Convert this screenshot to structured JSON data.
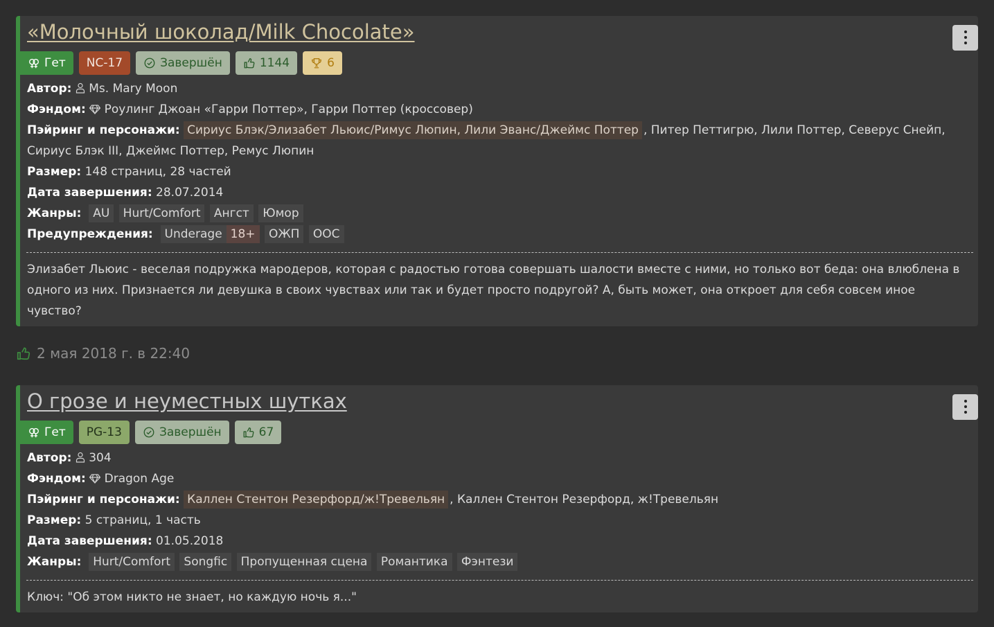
{
  "fics": [
    {
      "title": "«Молочный шоколад/Milk Chocolate»",
      "direction": "Гет",
      "rating": "NC-17",
      "status": "Завершён",
      "likes": "1144",
      "awards": "6",
      "author_label": "Автор:",
      "author": "Ms. Mary Moon",
      "fandom_label": "Фэндом:",
      "fandom": "Роулинг Джоан «Гарри Поттер», Гарри Поттер (кроссовер)",
      "pairing_label": "Пэйринг и персонажи:",
      "pairing_highlight": "Сириус Блэк/Элизабет Льюис/Римус Люпин, Лили Эванс/Джеймс Поттер",
      "pairing_rest_line1": ", Питер Петтигрю, Лили Поттер, Северус Снейп,",
      "pairing_rest_line2": "Сириус Блэк III, Джеймс Поттер, Ремус Люпин",
      "size_label": "Размер:",
      "size": "148 страниц, 28 частей",
      "date_label": "Дата завершения:",
      "date": "28.07.2014",
      "genres_label": "Жанры:",
      "genres": [
        "AU",
        "Hurt/Comfort",
        "Ангст",
        "Юмор"
      ],
      "warnings_label": "Предупреждения:",
      "warnings": [
        "Underage",
        "18+",
        "ОЖП",
        "ООС"
      ],
      "description": "Элизабет Льюис - веселая подружка мародеров, которая с радостью готова совершать шалости вместе с ними, но только вот беда: она влюблена в одного из них. Признается ли девушка в своих чувствах или так и будет просто подругой? А, быть может, она откроет для себя совсем иное чувство?"
    },
    {
      "title": "О грозе и неуместных шутках",
      "direction": "Гет",
      "rating": "PG-13",
      "status": "Завершён",
      "likes": "67",
      "author_label": "Автор:",
      "author": "304",
      "fandom_label": "Фэндом:",
      "fandom": "Dragon Age",
      "pairing_label": "Пэйринг и персонажи:",
      "pairing_highlight": "Каллен Стентон Резерфорд/ж!Тревельян",
      "pairing_rest_line1": ", Каллен Стентон Резерфорд, ж!Тревельян",
      "size_label": "Размер:",
      "size": "5 страниц, 1 часть",
      "date_label": "Дата завершения:",
      "date": "01.05.2018",
      "genres_label": "Жанры:",
      "genres": [
        "Hurt/Comfort",
        "Songfic",
        "Пропущенная сцена",
        "Романтика",
        "Фэнтези"
      ],
      "description": "Ключ: \"Об этом никто не знает, но каждую ночь я...\""
    }
  ],
  "liked_date": "2 мая 2018 г. в 22:40",
  "icons": {
    "direction": "gender-icon",
    "status": "check-circle-icon",
    "likes": "thumbs-up-icon",
    "awards": "trophy-icon",
    "author": "person-icon",
    "fandom": "diamond-icon",
    "menu": "kebab-menu-icon"
  },
  "colors": {
    "page_bg": "#2d2d2d",
    "card_bg": "#3a3a3a",
    "accent_green": "#3e8e41",
    "rating_nc17": "#a34a2a",
    "rating_pg13": "#8ca86a"
  }
}
